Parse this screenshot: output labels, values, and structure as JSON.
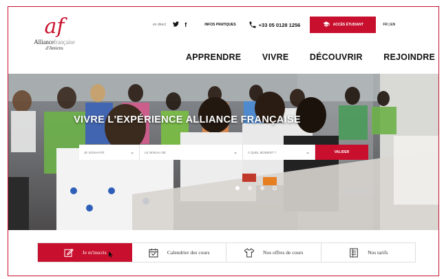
{
  "logo": {
    "mark": "af",
    "name_strong": "Alliance",
    "name_light": "française",
    "city": "d'Amiens"
  },
  "topbar": {
    "live_label": "en direct",
    "social": {
      "twitter": "𝕏",
      "facebook": "f"
    },
    "info_label": "INFOS PRATIQUES",
    "phone": "+33 05 0128 1256",
    "access_label": "ACCÈS ÉTUDIANT",
    "lang": "FR | EN"
  },
  "nav": {
    "items": [
      "APPRENDRE",
      "VIVRE",
      "DÉCOUVRIR",
      "REJOINDRE"
    ]
  },
  "hero": {
    "title": "VIVRE L'EXPÉRIENCE ALLIANCE FRANÇAISE",
    "selects": [
      {
        "value": "JE SOUHAITE"
      },
      {
        "value": "LE NIVEAU DE"
      },
      {
        "value": "À QUEL MOMENT ?"
      }
    ],
    "submit_label": "VALIDER",
    "slides": 4,
    "active_slide": 1
  },
  "tabs": [
    {
      "label": "Je m'inscris",
      "icon": "edit-icon"
    },
    {
      "label": "Calendrier des cours",
      "icon": "calendar-icon"
    },
    {
      "label": "Nos offres de cours",
      "icon": "shirt-icon"
    },
    {
      "label": "Nos tarifs",
      "icon": "price-list-icon"
    }
  ],
  "colors": {
    "brand": "#c8102e",
    "text": "#111111"
  }
}
